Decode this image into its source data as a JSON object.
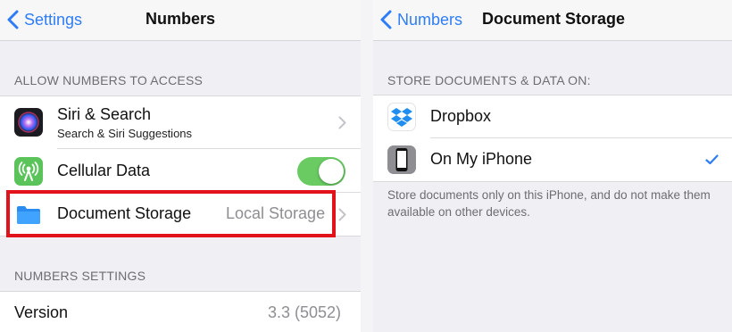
{
  "left": {
    "nav": {
      "back_label": "Settings",
      "title": "Numbers"
    },
    "allow_header": "ALLOW NUMBERS TO ACCESS",
    "rows": [
      {
        "label": "Siri & Search",
        "sublabel": "Search & Siri Suggestions",
        "icon": "siri-icon"
      },
      {
        "label": "Cellular Data",
        "icon": "cellular-icon",
        "toggle_on": true
      },
      {
        "label": "Document Storage",
        "value": "Local Storage",
        "icon": "folder-icon"
      }
    ],
    "settings_header": "NUMBERS SETTINGS",
    "version": {
      "label": "Version",
      "value": "3.3 (5052)"
    }
  },
  "right": {
    "nav": {
      "back_label": "Numbers",
      "title": "Document Storage"
    },
    "header": "STORE DOCUMENTS & DATA ON:",
    "options": [
      {
        "label": "Dropbox",
        "icon": "dropbox-icon",
        "selected": false
      },
      {
        "label": "On My iPhone",
        "icon": "iphone-icon",
        "selected": true
      }
    ],
    "footer": "Store documents only on this iPhone, and do not make them available on other devices."
  },
  "colors": {
    "accent": "#2f7df6",
    "toggle_on": "#6acb63",
    "highlight": "#e2121b",
    "background": "#efeff4"
  }
}
